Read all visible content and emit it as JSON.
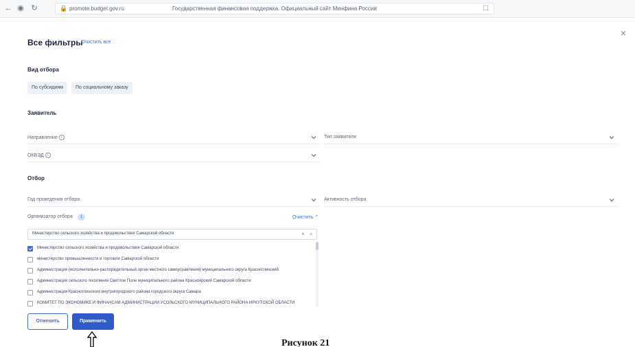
{
  "browser": {
    "url": "promote.budget.gov.ru",
    "title": "Государственная финансовая поддержка. Официальный сайт Минфина России"
  },
  "modal": {
    "title": "Все фильтры",
    "clear_all": "Очистить все",
    "close": "×"
  },
  "selection_type": {
    "title": "Вид отбора",
    "chips": [
      "По субсидиям",
      "По социальному заказу"
    ]
  },
  "applicant": {
    "title": "Заявитель",
    "direction_label": "Направление",
    "applicant_type_label": "Тип заявителя",
    "okved_label": "ОКВЭД"
  },
  "selection": {
    "title": "Отбор",
    "year_label": "Год проведения отбора",
    "activity_label": "Активность отбора",
    "organizer_label": "Организатор отбора",
    "organizer_count": "1",
    "organizer_clear": "Очистить",
    "search_value": "Министерство сельского хозяйства и продовольствия Самарской области",
    "options": [
      {
        "text": "Министерство сельского хозяйства и продовольствия Самарской области",
        "checked": true
      },
      {
        "text": "министерство промышленности и торговли Самарской области",
        "checked": false
      },
      {
        "text": "Администрация (исполнительно-распорядительный орган местного самоуправления) муниципального округа Красноглинский",
        "checked": false
      },
      {
        "text": "Администрация сельского поселения Светлое Поле муниципального района Красноярский Самарской области",
        "checked": false
      },
      {
        "text": "Администрация Красноглинского внутригородского района городского округа Самара",
        "checked": false
      },
      {
        "text": "КОМИТЕТ ПО ЭКОНОМИКЕ И ФИНАНСАМ АДМИНИСТРАЦИИ УСОЛЬСКОГО МУНИЦИПАЛЬНОГО РАЙОНА ИРКУТСКОЙ ОБЛАСТИ",
        "checked": false
      }
    ]
  },
  "actions": {
    "cancel": "Отменить",
    "apply": "Применить"
  },
  "caption": "Рисунок 21",
  "colors": {
    "accent": "#3e6dd8",
    "apply_bg": "#2e5bc7",
    "chip_bg": "#eef2f8"
  }
}
